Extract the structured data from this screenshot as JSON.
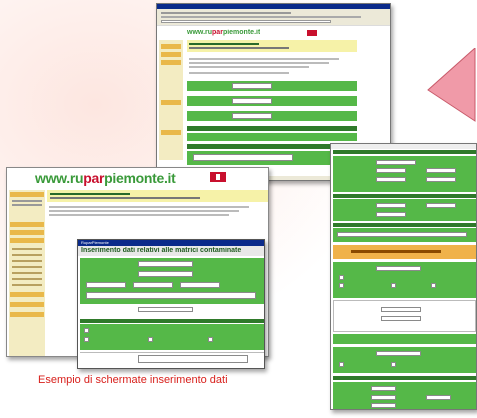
{
  "caption": "Esempio di schermate inserimento dati",
  "logo": {
    "prefix": "www.",
    "ru": "ru",
    "par": "par",
    "piemonte": "piemonte",
    "tld": ".it"
  },
  "form": {
    "title": "Inserimento dati relativi alle matrici contaminate",
    "dialog_title": "RuparPiemonte"
  },
  "colors": {
    "accent_green": "#55b848",
    "dark_green": "#2f7a2a",
    "logo_green": "#3a9a3a",
    "logo_red": "#c8102e",
    "arrow_pink": "#f09aa8",
    "caption_red": "#d8201c"
  }
}
